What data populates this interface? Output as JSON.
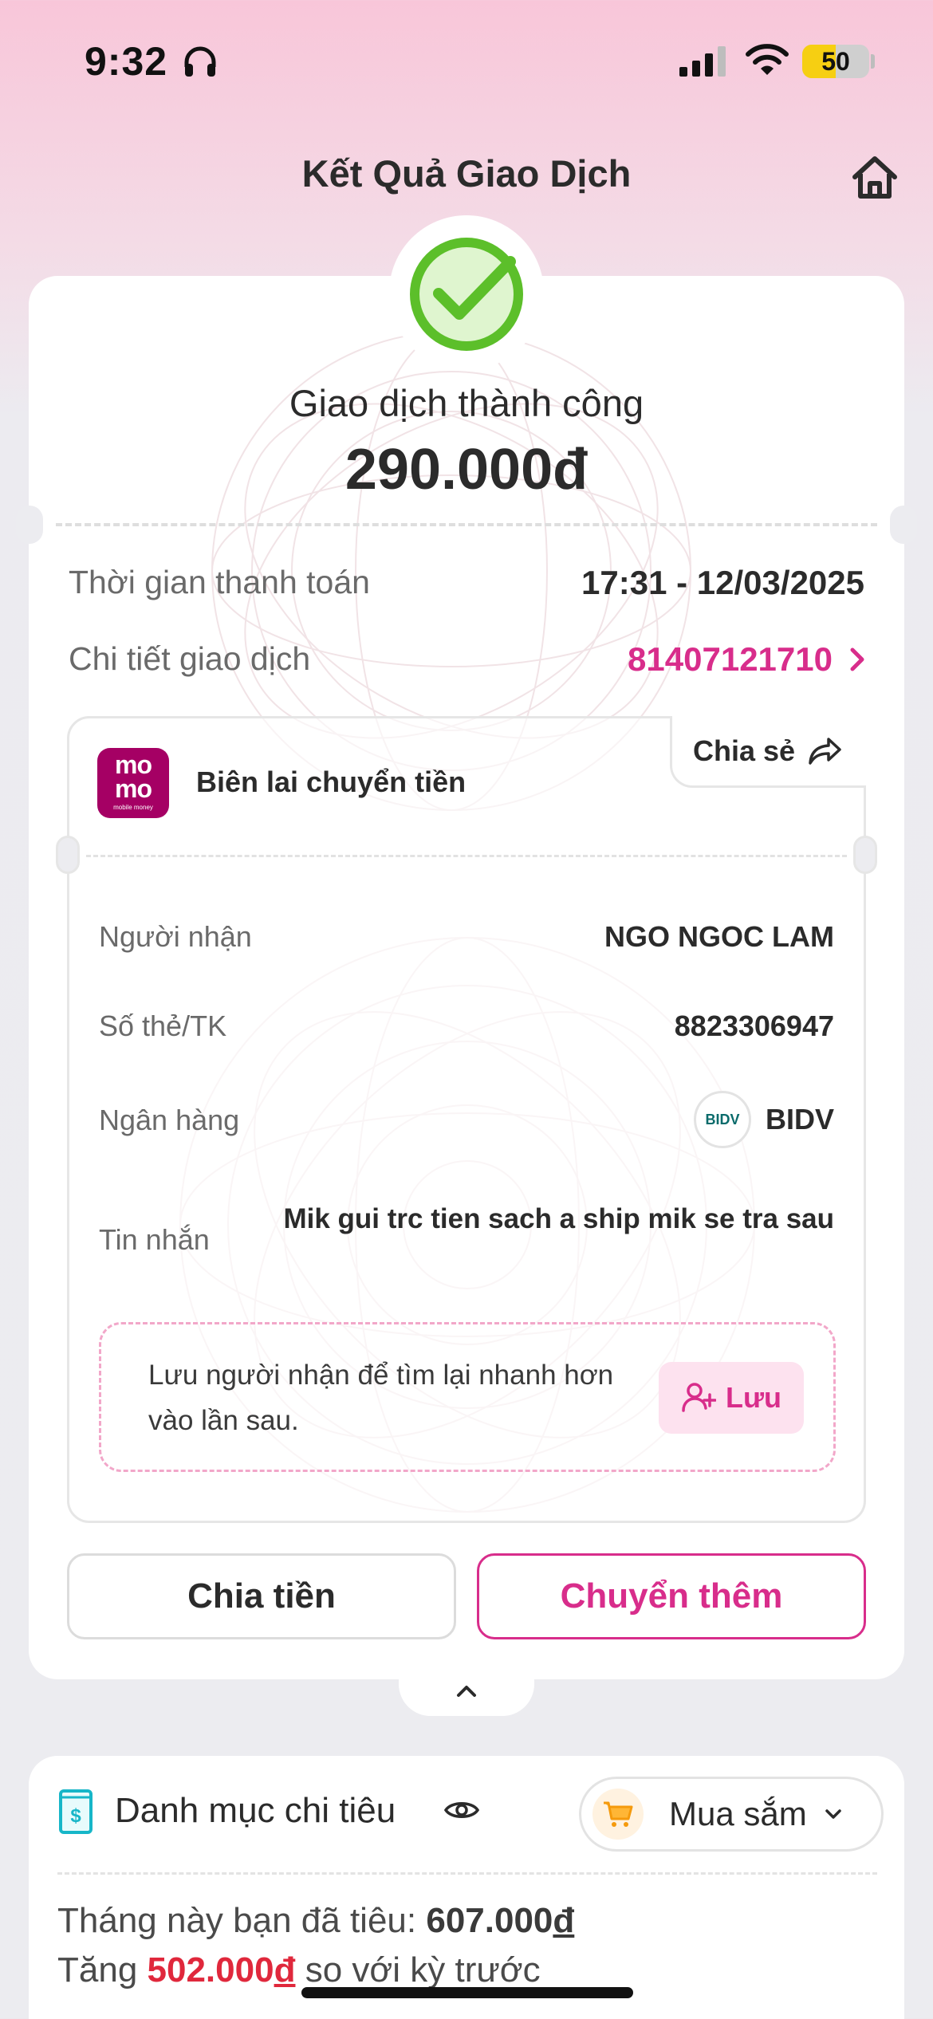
{
  "status_bar": {
    "time": "9:32",
    "battery_percent": "50",
    "battery_level": 0.5
  },
  "header": {
    "title": "Kết Quả Giao Dịch"
  },
  "result": {
    "status_text": "Giao dịch thành công",
    "amount": "290.000đ"
  },
  "info": {
    "time_label": "Thời gian thanh toán",
    "time_value": "17:31 - 12/03/2025",
    "detail_label": "Chi tiết giao dịch",
    "detail_value": "81407121710"
  },
  "receipt": {
    "logo_line1": "mo",
    "logo_line2": "mo",
    "logo_sub": "mobile money",
    "title": "Biên lai chuyển tiền",
    "share_label": "Chia sẻ",
    "rows": {
      "recipient_label": "Người nhận",
      "recipient_value": "NGO NGOC LAM",
      "account_label": "Số thẻ/TK",
      "account_value": "8823306947",
      "bank_label": "Ngân hàng",
      "bank_logo": "BIDV",
      "bank_value": "BIDV",
      "message_label": "Tin nhắn",
      "message_value": "Mik gui trc tien sach a ship mik se tra sau"
    },
    "save_prompt": "Lưu người nhận để tìm lại nhanh hơn vào lần sau.",
    "save_button": "Lưu"
  },
  "actions": {
    "split_label": "Chia tiền",
    "transfer_more_label": "Chuyển thêm"
  },
  "spending": {
    "title": "Danh mục chi tiêu",
    "category": "Mua sắm",
    "line1_prefix": "Tháng này bạn đã tiêu: ",
    "line1_amount": "607.000",
    "line1_currency": "đ",
    "line2_prefix": "Tăng ",
    "line2_amount": "502.000",
    "line2_currency": "đ",
    "line2_suffix": " so với kỳ trước"
  },
  "icons": {
    "headphones": "headphones-icon",
    "signal": "signal-icon",
    "wifi": "wifi-icon",
    "home": "home-icon",
    "check": "check-circle-icon",
    "chevron": "chevron-right-icon",
    "share": "share-arrow-icon",
    "add_user": "add-user-icon",
    "expand": "chevron-up-icon",
    "wallet": "wallet-icon",
    "eye": "eye-icon",
    "cart": "cart-icon",
    "dropdown": "chevron-down-icon"
  },
  "colors": {
    "brand_pink": "#d82d8b",
    "momo_purple": "#a50064",
    "success_green": "#5cbf2a",
    "increase_red": "#e0283c"
  }
}
